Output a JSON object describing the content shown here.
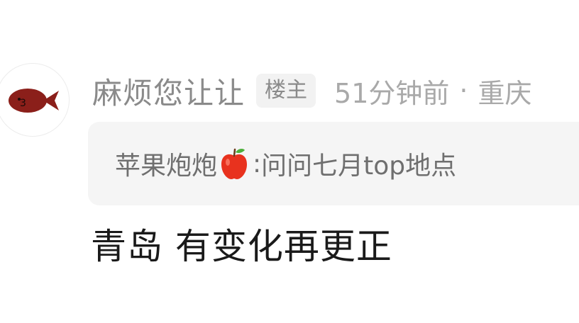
{
  "comment": {
    "avatar_icon": "red-fish-avatar",
    "username": "麻烦您让让",
    "badge": "楼主",
    "time": "51分钟前",
    "separator": "·",
    "location": "重庆",
    "quote": {
      "author": "苹果炮炮",
      "author_icon": "red-apple-emoji",
      "colon": ": ",
      "text": "问问七月top地点"
    },
    "body": "青岛 有变化再更正"
  },
  "colors": {
    "username": "#8a8a8a",
    "meta": "#a9a9a9",
    "quote_bg": "#f5f5f5",
    "body": "#1a1a1a",
    "fish": "#8b1f1a",
    "apple": "#e8321e"
  }
}
